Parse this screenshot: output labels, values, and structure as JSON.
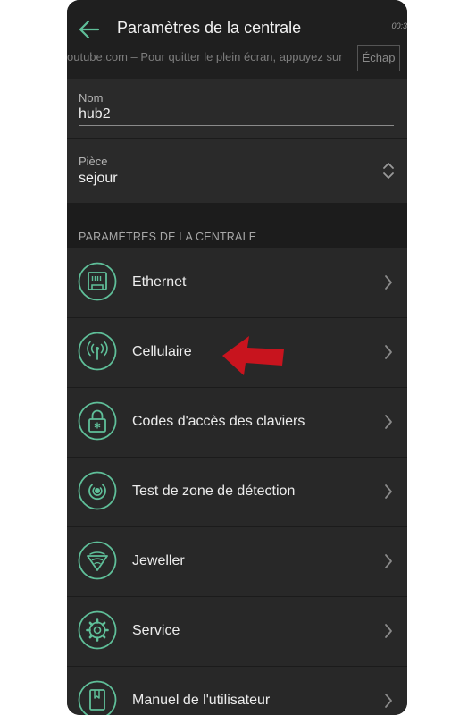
{
  "header": {
    "title": "Paramètres de la centrale",
    "clock": "00:3",
    "overlay_text": "outube.com – Pour quitter le plein écran, appuyez sur",
    "escape_key": "Échap"
  },
  "fields": {
    "name": {
      "label": "Nom",
      "value": "hub2"
    },
    "room": {
      "label": "Pièce",
      "value": "sejour"
    }
  },
  "section": {
    "title": "PARAMÈTRES DE LA CENTRALE"
  },
  "menu": [
    {
      "label": "Ethernet",
      "icon": "ethernet-icon"
    },
    {
      "label": "Cellulaire",
      "icon": "antenna-icon"
    },
    {
      "label": "Codes d'accès des claviers",
      "icon": "lock-icon"
    },
    {
      "label": "Test de zone de détection",
      "icon": "detection-icon"
    },
    {
      "label": "Jeweller",
      "icon": "jeweller-icon"
    },
    {
      "label": "Service",
      "icon": "gear-icon"
    },
    {
      "label": "Manuel de l'utilisateur",
      "icon": "book-icon"
    }
  ],
  "colors": {
    "accent": "#5fbf99",
    "annotation_arrow": "#c8141e",
    "background": "#252525"
  }
}
